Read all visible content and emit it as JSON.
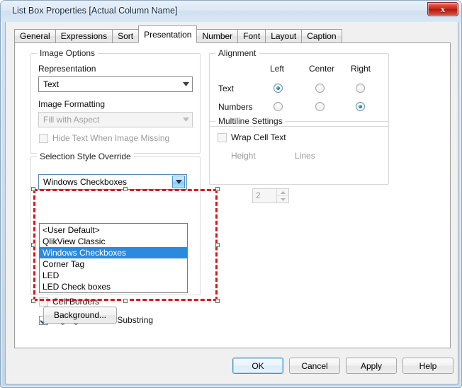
{
  "window": {
    "title": "List Box Properties [Actual Column Name]",
    "close_label": "x"
  },
  "tabs": [
    {
      "label": "General",
      "active": false
    },
    {
      "label": "Expressions",
      "active": false
    },
    {
      "label": "Sort",
      "active": false
    },
    {
      "label": "Presentation",
      "active": true
    },
    {
      "label": "Number",
      "active": false
    },
    {
      "label": "Font",
      "active": false
    },
    {
      "label": "Layout",
      "active": false
    },
    {
      "label": "Caption",
      "active": false
    }
  ],
  "image_options": {
    "group_title": "Image Options",
    "representation_label": "Representation",
    "representation_value": "Text",
    "image_formatting_label": "Image Formatting",
    "image_formatting_value": "Fill with Aspect",
    "hide_text_label": "Hide Text When Image Missing",
    "hide_text_checked": false
  },
  "alignment": {
    "group_title": "Alignment",
    "columns": [
      "Left",
      "Center",
      "Right"
    ],
    "rows": [
      {
        "label": "Text",
        "selected": "Left"
      },
      {
        "label": "Numbers",
        "selected": "Right"
      }
    ]
  },
  "multiline": {
    "group_title": "Multiline Settings",
    "wrap_cell_text_label": "Wrap Cell Text",
    "wrap_cell_text_checked": false,
    "height_label": "Height",
    "height_value": "2",
    "lines_label": "Lines"
  },
  "selection_style": {
    "group_title": "Selection Style Override",
    "selected_value": "Windows Checkboxes",
    "options": [
      "<User Default>",
      "QlikView Classic",
      "Windows Checkboxes",
      "Corner Tag",
      "LED",
      "LED Check boxes"
    ],
    "highlighted_index": 2
  },
  "other_options": {
    "cell_borders_label": "Cell Borders",
    "cell_borders_checked": false,
    "highlight_search_label": "Highlight Search Substring",
    "highlight_search_checked": true,
    "background_button": "Background..."
  },
  "footer": {
    "ok": "OK",
    "cancel": "Cancel",
    "apply": "Apply",
    "help": "Help"
  },
  "colors": {
    "accent_highlight": "#2a8ae0",
    "selection_marquee": "#e0141e",
    "close_button": "#c42418"
  }
}
